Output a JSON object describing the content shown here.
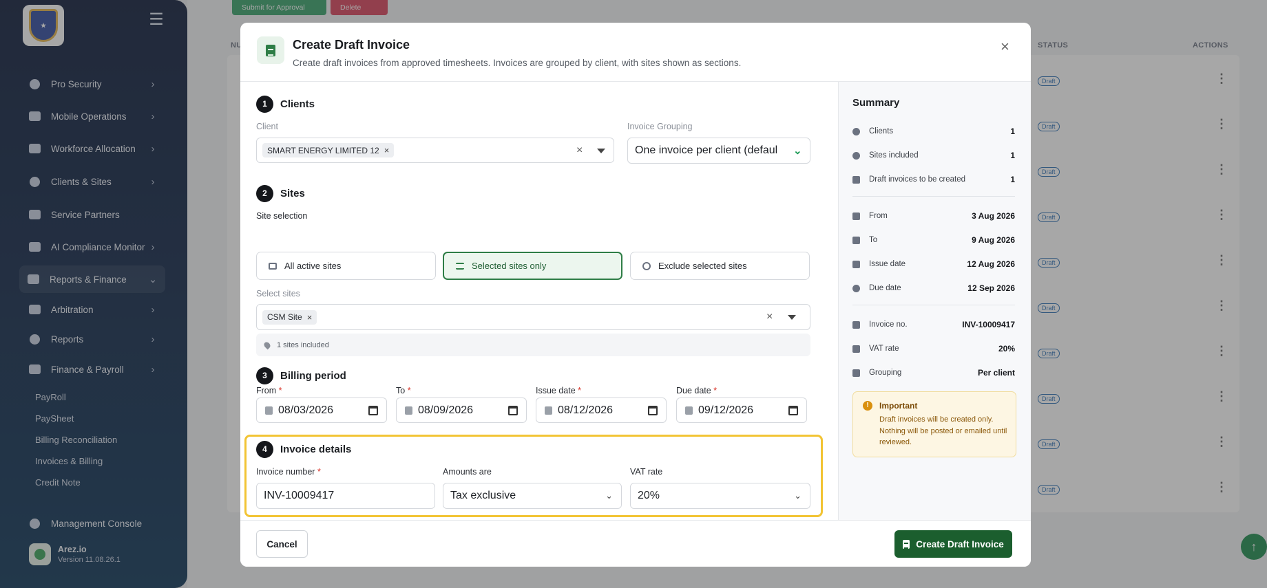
{
  "sidebar": {
    "items": [
      {
        "label": "Pro Security"
      },
      {
        "label": "Mobile Operations"
      },
      {
        "label": "Workforce Allocation"
      },
      {
        "label": "Clients & Sites"
      },
      {
        "label": "Service Partners"
      },
      {
        "label": "AI Compliance Monitor"
      },
      {
        "label": "Reports & Finance"
      },
      {
        "label": "Arbitration"
      },
      {
        "label": "Reports"
      },
      {
        "label": "Finance & Payroll"
      }
    ],
    "sub_items": [
      "PayRoll",
      "PaySheet",
      "Billing Reconciliation",
      "Invoices & Billing",
      "Credit Note"
    ],
    "management": "Management Console",
    "org_name": "Arez.io",
    "org_version": "Version 11.08.26.1"
  },
  "background": {
    "submit_label": "Submit for Approval",
    "delete_label": "Delete",
    "col_status": "STATUS",
    "col_actions": "ACTIONS",
    "col_num": "NU",
    "badge": "Draft"
  },
  "modal": {
    "title": "Create Draft Invoice",
    "subtitle": "Create draft invoices from approved timesheets. Invoices are grouped by client, with sites shown as sections.",
    "close": "×",
    "sections": {
      "clients": {
        "num": "1",
        "title": "Clients",
        "client_label": "Client",
        "client_chip": "SMART ENERGY LIMITED 12",
        "grouping_label": "Invoice Grouping",
        "grouping_value": "One invoice per client (defaul"
      },
      "sites": {
        "num": "2",
        "title": "Sites",
        "selection_label": "Site selection",
        "opt_all": "All active sites",
        "opt_selected": "Selected sites only",
        "opt_exclude": "Exclude selected sites",
        "select_label": "Select sites",
        "site_chip": "CSM Site",
        "included_text": "1 sites included"
      },
      "billing": {
        "num": "3",
        "title": "Billing period",
        "from_label": "From",
        "to_label": "To",
        "issue_label": "Issue date",
        "due_label": "Due date",
        "from": "08/03/2026",
        "to": "08/09/2026",
        "issue": "08/12/2026",
        "due": "09/12/2026"
      },
      "details": {
        "num": "4",
        "title": "Invoice details",
        "invoice_label": "Invoice number",
        "amounts_label": "Amounts are",
        "vat_label": "VAT rate",
        "invoice_value": "INV-10009417",
        "amounts_value": "Tax exclusive",
        "vat_value": "20%"
      }
    },
    "summary": {
      "title": "Summary",
      "rows": [
        {
          "label": "Clients",
          "value": "1"
        },
        {
          "label": "Sites included",
          "value": "1"
        },
        {
          "label": "Draft invoices to be created",
          "value": "1"
        },
        {
          "label": "From",
          "value": "3 Aug 2026"
        },
        {
          "label": "To",
          "value": "9 Aug 2026"
        },
        {
          "label": "Issue date",
          "value": "12 Aug 2026"
        },
        {
          "label": "Due date",
          "value": "12 Sep 2026"
        },
        {
          "label": "Invoice no.",
          "value": "INV-10009417"
        },
        {
          "label": "VAT rate",
          "value": "20%"
        },
        {
          "label": "Grouping",
          "value": "Per client"
        }
      ],
      "important_title": "Important",
      "important_text": "Draft invoices will be created only. Nothing will be posted or emailed until reviewed."
    },
    "footer": {
      "cancel": "Cancel",
      "create": "Create Draft Invoice"
    }
  },
  "colors": {
    "accent_green": "#1b5e2e",
    "highlight": "#f2c434",
    "sidebar_bg": "#0d1b3a"
  }
}
